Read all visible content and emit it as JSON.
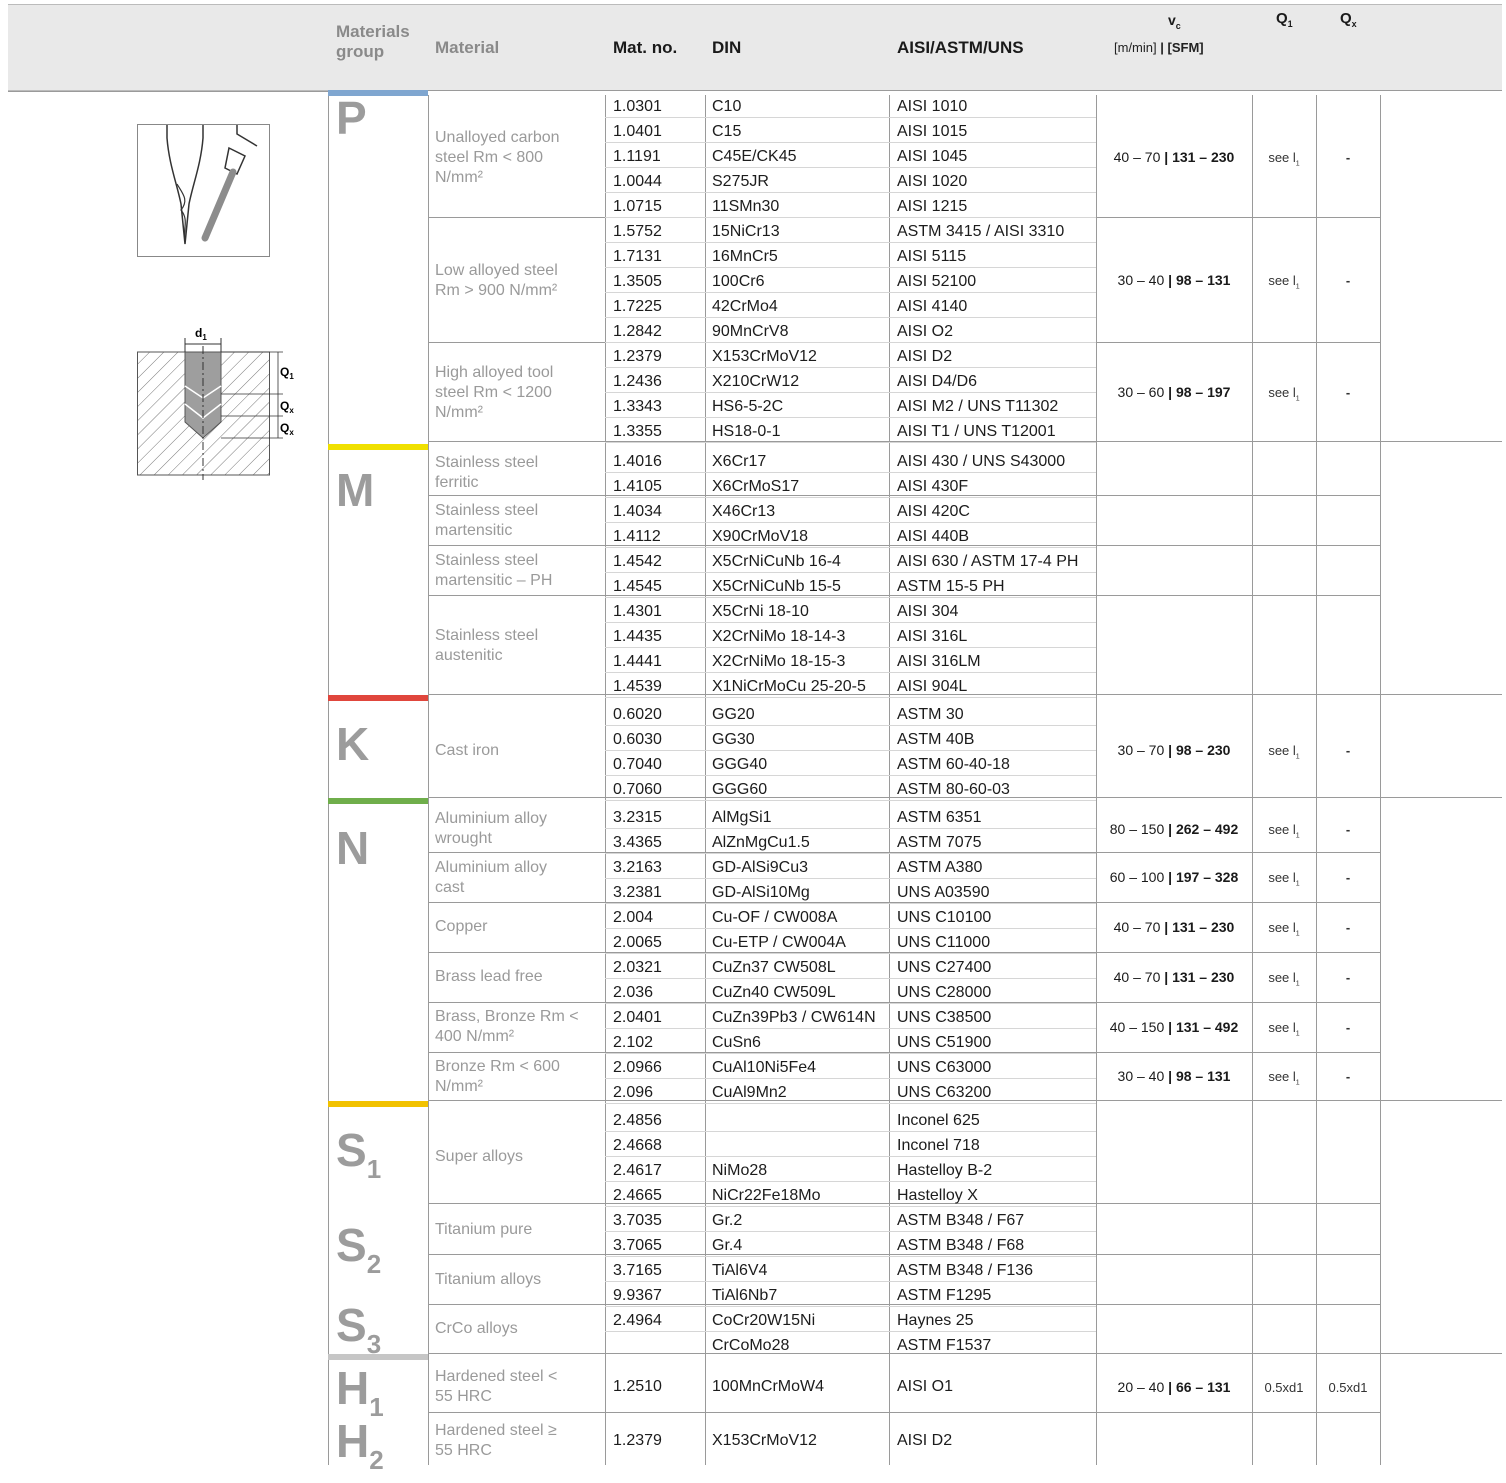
{
  "header": {
    "materials_group": "Materials group",
    "material": "Material",
    "mat_no": "Mat. no.",
    "din": "DIN",
    "aisi": "AISI/ASTM/UNS",
    "vc": "v",
    "vc_sub": "c",
    "vc_units": "[m/min]",
    "vc_units2": "[SFM]",
    "q1": "Q",
    "q1_sub": "1",
    "qx": "Q",
    "qx_sub": "x"
  },
  "diagram": {
    "d_label": "d",
    "d_sub": "1",
    "q1": "Q",
    "q1_sub": "1",
    "qx": "Q",
    "qx_sub": "x"
  },
  "colors": {
    "P": "#7fa6d0",
    "M": "#f0e000",
    "K": "#e0463c",
    "N": "#6fae4b",
    "S": "#f2c200",
    "H": "#c6c6c6"
  },
  "groups": {
    "P": "P",
    "M": "M",
    "K": "K",
    "N": "N",
    "S": "S",
    "S1": "1",
    "S2": "2",
    "S3": "3",
    "H": "H",
    "H1": "1",
    "H2": "2"
  },
  "materials": [
    {
      "name": "Unalloyed carbon steel Rm < 800 N/mm²"
    },
    {
      "name": "Low alloyed steel Rm > 900 N/mm²"
    },
    {
      "name": "High alloyed tool steel Rm < 1200 N/mm²"
    },
    {
      "name": "Stainless steel ferritic"
    },
    {
      "name": "Stainless steel martensitic"
    },
    {
      "name": "Stainless steel martensitic – PH"
    },
    {
      "name": "Stainless steel austenitic"
    },
    {
      "name": "Cast iron"
    },
    {
      "name": "Aluminium alloy wrought"
    },
    {
      "name": "Aluminium alloy cast"
    },
    {
      "name": "Copper"
    },
    {
      "name": "Brass lead free"
    },
    {
      "name": "Brass, Bronze Rm < 400 N/mm²"
    },
    {
      "name": "Bronze Rm < 600 N/mm²"
    },
    {
      "name": "Super alloys"
    },
    {
      "name": "Titanium pure"
    },
    {
      "name": "Titanium alloys"
    },
    {
      "name": "CrCo alloys"
    },
    {
      "name": "Hardened steel < 55 HRC"
    },
    {
      "name": "Hardened steel ≥ 55 HRC"
    }
  ],
  "rows": [
    [
      "1.0301",
      "C10",
      "AISI 1010"
    ],
    [
      "1.0401",
      "C15",
      "AISI 1015"
    ],
    [
      "1.1191",
      "C45E/CK45",
      "AISI 1045"
    ],
    [
      "1.0044",
      "S275JR",
      "AISI 1020"
    ],
    [
      "1.0715",
      "11SMn30",
      "AISI 1215"
    ],
    [
      "1.5752",
      "15NiCr13",
      "ASTM 3415 / AISI 3310"
    ],
    [
      "1.7131",
      "16MnCr5",
      "AISI 5115"
    ],
    [
      "1.3505",
      "100Cr6",
      "AISI 52100"
    ],
    [
      "1.7225",
      "42CrMo4",
      "AISI 4140"
    ],
    [
      "1.2842",
      "90MnCrV8",
      "AISI O2"
    ],
    [
      "1.2379",
      "X153CrMoV12",
      "AISI D2"
    ],
    [
      "1.2436",
      "X210CrW12",
      "AISI D4/D6"
    ],
    [
      "1.3343",
      "HS6-5-2C",
      "AISI M2 / UNS T11302"
    ],
    [
      "1.3355",
      "HS18-0-1",
      "AISI T1 / UNS T12001"
    ],
    [
      "1.4016",
      "X6Cr17",
      "AISI 430 / UNS S43000"
    ],
    [
      "1.4105",
      "X6CrMoS17",
      "AISI 430F"
    ],
    [
      "1.4034",
      "X46Cr13",
      "AISI 420C"
    ],
    [
      "1.4112",
      "X90CrMoV18",
      "AISI 440B"
    ],
    [
      "1.4542",
      "X5CrNiCuNb 16-4",
      "AISI 630 / ASTM 17-4 PH"
    ],
    [
      "1.4545",
      "X5CrNiCuNb 15-5",
      "ASTM 15-5 PH"
    ],
    [
      "1.4301",
      "X5CrNi 18-10",
      "AISI 304"
    ],
    [
      "1.4435",
      "X2CrNiMo 18-14-3",
      "AISI 316L"
    ],
    [
      "1.4441",
      "X2CrNiMo 18-15-3",
      "AISI 316LM"
    ],
    [
      "1.4539",
      "X1NiCrMoCu 25-20-5",
      "AISI 904L"
    ],
    [
      "0.6020",
      "GG20",
      "ASTM 30"
    ],
    [
      "0.6030",
      "GG30",
      "ASTM 40B"
    ],
    [
      "0.7040",
      "GGG40",
      "ASTM 60-40-18"
    ],
    [
      "0.7060",
      "GGG60",
      "ASTM 80-60-03"
    ],
    [
      "3.2315",
      "AlMgSi1",
      "ASTM 6351"
    ],
    [
      "3.4365",
      "AlZnMgCu1.5",
      "ASTM 7075"
    ],
    [
      "3.2163",
      "GD-AlSi9Cu3",
      "ASTM A380"
    ],
    [
      "3.2381",
      "GD-AlSi10Mg",
      "UNS A03590"
    ],
    [
      "2.004",
      "Cu-OF / CW008A",
      "UNS C10100"
    ],
    [
      "2.0065",
      "Cu-ETP / CW004A",
      "UNS C11000"
    ],
    [
      "2.0321",
      "CuZn37 CW508L",
      "UNS C27400"
    ],
    [
      "2.036",
      "CuZn40 CW509L",
      "UNS C28000"
    ],
    [
      "2.0401",
      "CuZn39Pb3 / CW614N",
      "UNS C38500"
    ],
    [
      "2.102",
      "CuSn6",
      "UNS C51900"
    ],
    [
      "2.0966",
      "CuAl10Ni5Fe4",
      "UNS C63000"
    ],
    [
      "2.096",
      "CuAl9Mn2",
      "UNS C63200"
    ],
    [
      "2.4856",
      "",
      "Inconel 625"
    ],
    [
      "2.4668",
      "",
      "Inconel 718"
    ],
    [
      "2.4617",
      "NiMo28",
      "Hastelloy B-2"
    ],
    [
      "2.4665",
      "NiCr22Fe18Mo",
      "Hastelloy X"
    ],
    [
      "3.7035",
      "Gr.2",
      "ASTM B348 / F67"
    ],
    [
      "3.7065",
      "Gr.4",
      "ASTM B348 / F68"
    ],
    [
      "3.7165",
      "TiAl6V4",
      "ASTM B348 / F136"
    ],
    [
      "9.9367",
      "TiAl6Nb7",
      "ASTM F1295"
    ],
    [
      "2.4964",
      "CoCr20W15Ni",
      "Haynes 25"
    ],
    [
      "",
      "CrCoMo28",
      "ASTM F1537"
    ],
    [
      "1.2510",
      "100MnCrMoW4",
      "AISI O1"
    ],
    [
      "1.2379",
      "X153CrMoV12",
      "AISI D2"
    ]
  ],
  "vc": [
    {
      "a": "40 – 70",
      "b": "131 – 230",
      "q1": "see l",
      "q1_sub": "1",
      "qx": "-"
    },
    {
      "a": "30 – 40",
      "b": "98 – 131",
      "q1": "see l",
      "q1_sub": "1",
      "qx": "-"
    },
    {
      "a": "30 – 60",
      "b": "98 – 197",
      "q1": "see l",
      "q1_sub": "1",
      "qx": "-"
    },
    {
      "a": "30 – 70",
      "b": "98 – 230",
      "q1": "see l",
      "q1_sub": "1",
      "qx": "-"
    },
    {
      "a": "80 – 150",
      "b": "262 – 492",
      "q1": "see l",
      "q1_sub": "1",
      "qx": "-"
    },
    {
      "a": "60 – 100",
      "b": "197 – 328",
      "q1": "see l",
      "q1_sub": "1",
      "qx": "-"
    },
    {
      "a": "40 – 70",
      "b": "131 – 230",
      "q1": "see l",
      "q1_sub": "1",
      "qx": "-"
    },
    {
      "a": "40 – 70",
      "b": "131 – 230",
      "q1": "see l",
      "q1_sub": "1",
      "qx": "-"
    },
    {
      "a": "40 – 150",
      "b": "131 – 492",
      "q1": "see l",
      "q1_sub": "1",
      "qx": "-"
    },
    {
      "a": "30 – 40",
      "b": "98 – 131",
      "q1": "see l",
      "q1_sub": "1",
      "qx": "-"
    },
    {
      "a": "20 – 40",
      "b": "66 – 131",
      "q1": "0.5xd1",
      "q1_sub": "",
      "qx": "0.5xd1"
    }
  ]
}
